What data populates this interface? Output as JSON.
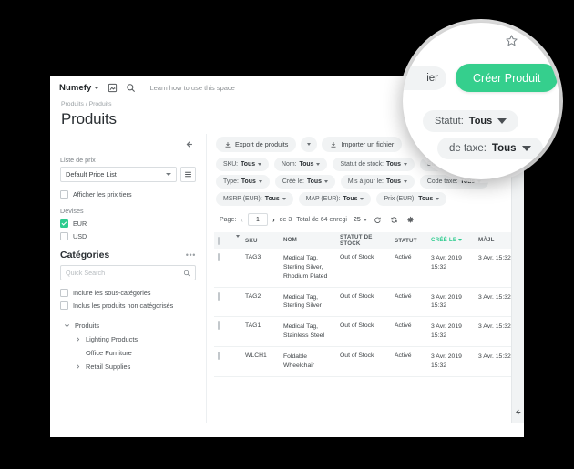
{
  "topbar": {
    "brand": "Numefy",
    "learn_link": "Learn how to use this space",
    "icons": [
      "bookmark-icon",
      "search-icon"
    ]
  },
  "breadcrumb": "Produits / Produits",
  "page_title": "Produits",
  "left_panel": {
    "price_list_label": "Liste de prix",
    "price_list_value": "Default Price List",
    "show_tier_prices_label": "Afficher les prix tiers",
    "currencies_label": "Devises",
    "currencies": [
      {
        "label": "EUR",
        "checked": true
      },
      {
        "label": "USD",
        "checked": false
      }
    ],
    "categories_title": "Catégories",
    "search_placeholder": "Quick Search",
    "include_subcategories_label": "Inclure les sous-catégories",
    "include_uncategorized_label": "Inclus les produits non catégorisés",
    "tree": [
      {
        "label": "Produits",
        "level": 0,
        "expanded": true
      },
      {
        "label": "Lighting Products",
        "level": 1,
        "expanded": false
      },
      {
        "label": "Office Furniture",
        "level": 1,
        "expanded": null
      },
      {
        "label": "Retail Supplies",
        "level": 1,
        "expanded": false
      }
    ]
  },
  "actions": {
    "export": "Export de produits",
    "import": "Importer un fichier",
    "create": "Créer Produit"
  },
  "filters_row1": [
    {
      "label": "SKU:",
      "value": "Tous"
    },
    {
      "label": "Nom:",
      "value": "Tous"
    },
    {
      "label": "Statut de stock:",
      "value": "Tous"
    },
    {
      "label": "Statut:",
      "value": "Tous"
    }
  ],
  "filters_row2": [
    {
      "label": "Type:",
      "value": "Tous"
    },
    {
      "label": "Créé le:",
      "value": "Tous"
    },
    {
      "label": "Mis à jour le:",
      "value": "Tous"
    },
    {
      "label": "Code taxe:",
      "value": "Tous"
    }
  ],
  "filters_row3": [
    {
      "label": "MSRP (EUR):",
      "value": "Tous"
    },
    {
      "label": "MAP (EUR):",
      "value": "Tous"
    },
    {
      "label": "Prix (EUR):",
      "value": "Tous"
    }
  ],
  "pager": {
    "page_label": "Page:",
    "page_value": "1",
    "of_label": "de 3",
    "total_label": "Total de 64 enregi",
    "per_page": "25",
    "icons": [
      "refresh-icon",
      "sync-icon",
      "gear-icon"
    ]
  },
  "table": {
    "headers": [
      "SKU",
      "NOM",
      "STATUT DE STOCK",
      "STATUT",
      "CRÉÉ LE",
      "MÀJL"
    ],
    "sorted_column": "CRÉÉ LE",
    "rows": [
      {
        "sku": "TAG3",
        "nom": "Medical Tag, Sterling Silver, Rhodium Plated",
        "stock": "Out of Stock",
        "statut": "Activé",
        "cree": "3 Avr. 2019 15:32",
        "majl": "3 Avr. 15:32"
      },
      {
        "sku": "TAG2",
        "nom": "Medical Tag, Sterling Silver",
        "stock": "Out of Stock",
        "statut": "Activé",
        "cree": "3 Avr. 2019 15:32",
        "majl": "3 Avr. 15:32"
      },
      {
        "sku": "TAG1",
        "nom": "Medical Tag, Stainless Steel",
        "stock": "Out of Stock",
        "statut": "Activé",
        "cree": "3 Avr. 2019 15:32",
        "majl": "3 Avr. 15:32"
      },
      {
        "sku": "WLCH1",
        "nom": "Foldable Wheelchair",
        "stock": "Out of Stock",
        "statut": "Activé",
        "cree": "3 Avr. 2019 15:32",
        "majl": "3 Avr. 15:32"
      }
    ]
  },
  "magnifier": {
    "partial_import_label": "ier",
    "create_button": "Créer Produit",
    "filter_status_label": "Statut:",
    "filter_status_value": "Tous",
    "filter_tax_label": "de taxe:",
    "filter_tax_value": "Tous",
    "star_icon": "star-outline-icon"
  },
  "colors": {
    "accent_green": "#35cf8d",
    "checkbox_green": "#2ecc8f",
    "pill_bg": "#f1f3f4",
    "page_bg": "#000000"
  }
}
